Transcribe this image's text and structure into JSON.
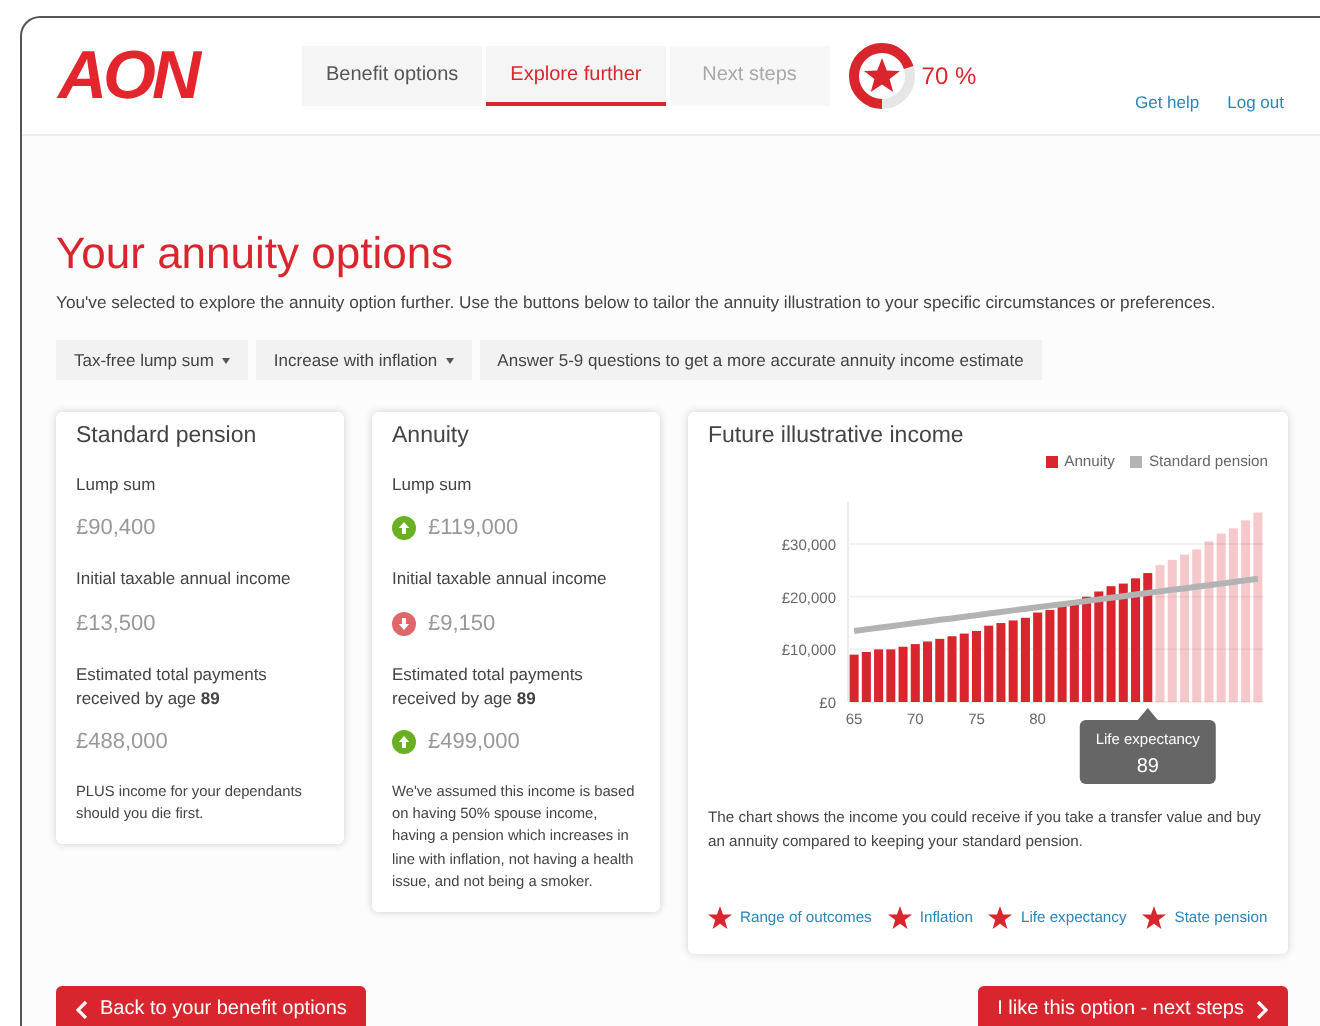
{
  "header": {
    "logo": "AON",
    "tabs": [
      {
        "label": "Benefit options",
        "selected": false,
        "disabled": false
      },
      {
        "label": "Explore further",
        "selected": true,
        "disabled": false
      },
      {
        "label": "Next steps",
        "selected": false,
        "disabled": true
      }
    ],
    "progress": {
      "level": 0.7,
      "reading": "70 %"
    },
    "links": [
      "Get help",
      "Log out"
    ]
  },
  "page": {
    "title": "Your annuity options",
    "intro": "You've selected to explore the annuity option further. Use the buttons below to tailor the annuity illustration to your specific circumstances or preferences.",
    "options": [
      {
        "label": "Tax-free lump sum",
        "dropdown": true
      },
      {
        "label": "Increase with inflation",
        "dropdown": true
      },
      {
        "label": "Answer 5-9 questions to get a more accurate annuity income estimate",
        "dropdown": false
      }
    ]
  },
  "cards": [
    {
      "title": "Standard pension",
      "items": [
        {
          "label": "Lump sum",
          "value": "£90,400",
          "kind": "plain"
        },
        {
          "label": "Initial taxable annual income",
          "value": "£13,500",
          "kind": "plain"
        },
        {
          "label": "Estimated total payments received by age **89**",
          "value": "£488,000",
          "kind": "plain"
        }
      ],
      "note": "PLUS income for your dependants should you die first."
    },
    {
      "title": "Annuity",
      "items": [
        {
          "label": "Lump sum",
          "value": "£119,000",
          "kind": "increase"
        },
        {
          "label": "Initial taxable annual income",
          "value": "£9,150",
          "kind": "decrease"
        },
        {
          "label": "Estimated total payments received by age **89**",
          "value": "£499,000",
          "kind": "increase"
        }
      ],
      "note": "We've assumed this income is based on having 50% spouse income, having a pension which increases in line with inflation, not having a health issue, and not being a smoker."
    }
  ],
  "chart_panel": {
    "title": "Future illustrative income",
    "tooltip": {
      "label": "Life expectancy",
      "value": "89"
    },
    "caption": "The chart shows the income you could receive if you take a transfer value and buy an annuity compared to keeping your standard pension.",
    "chart_data": {
      "type": "bar",
      "grid": true,
      "x": [
        65,
        66,
        67,
        68,
        69,
        70,
        71,
        72,
        73,
        74,
        75,
        76,
        77,
        78,
        79,
        80,
        81,
        82,
        83,
        84,
        85,
        86,
        87,
        88,
        89,
        90,
        91,
        92,
        93,
        94,
        95,
        96,
        97,
        98
      ],
      "series": [
        {
          "name": "Annuity",
          "type": "bar",
          "color": "#d9262e",
          "values": [
            9000,
            9500,
            10000,
            10000,
            10500,
            11000,
            11500,
            12000,
            12500,
            13000,
            13500,
            14500,
            15000,
            15500,
            16000,
            17000,
            17500,
            18500,
            19000,
            20000,
            21000,
            22000,
            22500,
            23500,
            24500,
            26000,
            27000,
            28000,
            29000,
            30500,
            32000,
            33000,
            34500,
            36000
          ]
        },
        {
          "name": "Standard pension",
          "type": "line",
          "color": "#b3b3b3",
          "values": [
            13500,
            13800,
            14100,
            14400,
            14700,
            15000,
            15300,
            15600,
            15900,
            16200,
            16500,
            16800,
            17100,
            17400,
            17700,
            18000,
            18300,
            18600,
            18900,
            19200,
            19500,
            19800,
            20100,
            20400,
            20700,
            21000,
            21300,
            21600,
            21900,
            22200,
            22500,
            22800,
            23100,
            23400
          ]
        }
      ],
      "xlim": [
        64.5,
        98.5
      ],
      "ylim": [
        0,
        38000
      ],
      "yticks": [
        {
          "value": 0,
          "label": "£0"
        },
        {
          "value": 10000,
          "label": "£10,000"
        },
        {
          "value": 20000,
          "label": "£20,000"
        },
        {
          "value": 30000,
          "label": "£30,000"
        }
      ],
      "xticks": [
        65,
        70,
        75,
        80
      ]
    },
    "links": [
      "Range of outcomes",
      "Inflation",
      "Life expectancy",
      "State pension"
    ]
  },
  "buttons": [
    {
      "label": "Back to your benefit options",
      "kind": "back"
    },
    {
      "label": "I like this option - next steps",
      "kind": "next"
    }
  ]
}
